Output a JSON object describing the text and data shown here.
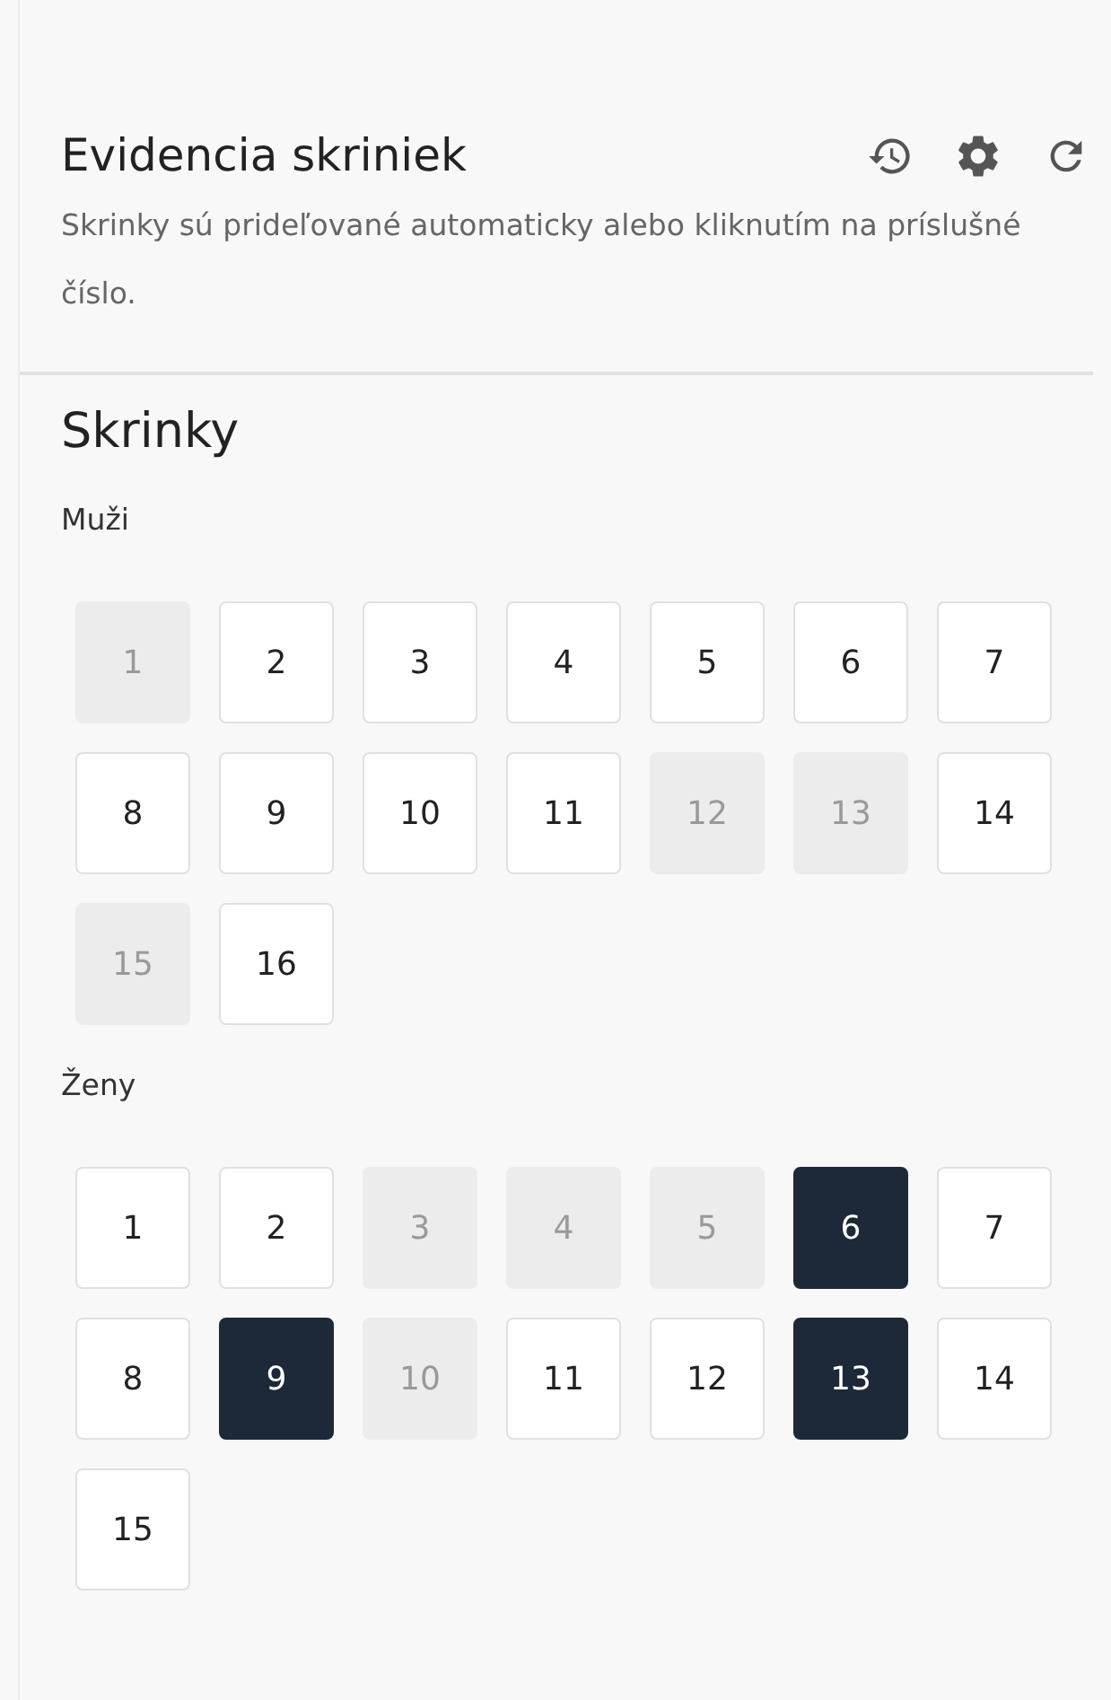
{
  "header": {
    "title": "Evidencia skriniek",
    "description": "Skrinky sú prideľované automaticky alebo kliknutím na príslušné číslo."
  },
  "section_title": "Skrinky",
  "groups": [
    {
      "label": "Muži",
      "lockers": [
        {
          "number": "1",
          "disabled": true,
          "selected": false
        },
        {
          "number": "2",
          "disabled": false,
          "selected": false
        },
        {
          "number": "3",
          "disabled": false,
          "selected": false
        },
        {
          "number": "4",
          "disabled": false,
          "selected": false
        },
        {
          "number": "5",
          "disabled": false,
          "selected": false
        },
        {
          "number": "6",
          "disabled": false,
          "selected": false
        },
        {
          "number": "7",
          "disabled": false,
          "selected": false
        },
        {
          "number": "8",
          "disabled": false,
          "selected": false
        },
        {
          "number": "9",
          "disabled": false,
          "selected": false
        },
        {
          "number": "10",
          "disabled": false,
          "selected": false
        },
        {
          "number": "11",
          "disabled": false,
          "selected": false
        },
        {
          "number": "12",
          "disabled": true,
          "selected": false
        },
        {
          "number": "13",
          "disabled": true,
          "selected": false
        },
        {
          "number": "14",
          "disabled": false,
          "selected": false
        },
        {
          "number": "15",
          "disabled": true,
          "selected": false
        },
        {
          "number": "16",
          "disabled": false,
          "selected": false
        }
      ]
    },
    {
      "label": "Ženy",
      "lockers": [
        {
          "number": "1",
          "disabled": false,
          "selected": false
        },
        {
          "number": "2",
          "disabled": false,
          "selected": false
        },
        {
          "number": "3",
          "disabled": true,
          "selected": false
        },
        {
          "number": "4",
          "disabled": true,
          "selected": false
        },
        {
          "number": "5",
          "disabled": true,
          "selected": false
        },
        {
          "number": "6",
          "disabled": false,
          "selected": true
        },
        {
          "number": "7",
          "disabled": false,
          "selected": false
        },
        {
          "number": "8",
          "disabled": false,
          "selected": false
        },
        {
          "number": "9",
          "disabled": false,
          "selected": true
        },
        {
          "number": "10",
          "disabled": true,
          "selected": false
        },
        {
          "number": "11",
          "disabled": false,
          "selected": false
        },
        {
          "number": "12",
          "disabled": false,
          "selected": false
        },
        {
          "number": "13",
          "disabled": false,
          "selected": true
        },
        {
          "number": "14",
          "disabled": false,
          "selected": false
        },
        {
          "number": "15",
          "disabled": false,
          "selected": false
        }
      ]
    }
  ]
}
